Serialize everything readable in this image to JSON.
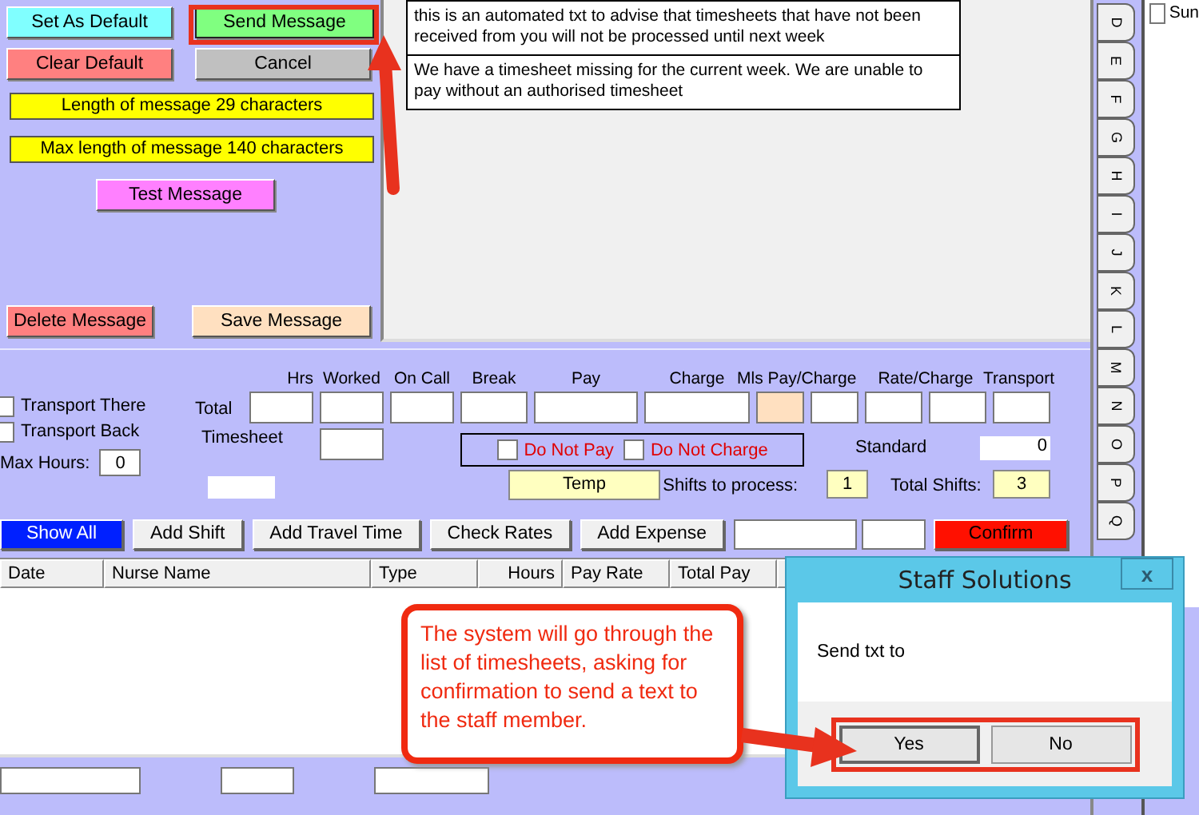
{
  "message_panel": {
    "set_default_button": "Set As Default",
    "send_message_button": "Send Message",
    "clear_default_button": "Clear Default",
    "cancel_button": "Cancel",
    "length_info": "Length of message 29 characters",
    "max_length_info": "Max length of message 140 characters",
    "test_message_button": "Test Message",
    "delete_message_button": "Delete Message",
    "save_message_button": "Save Message"
  },
  "messages": [
    "this is an automated txt to advise that  timesheets that have not been received from you will not be processed until next week",
    "We have a timesheet missing for the current week. We are unable to pay without an authorised timesheet"
  ],
  "letter_tabs": [
    "D",
    "E",
    "F",
    "G",
    "H",
    "I",
    "J",
    "K",
    "L",
    "M",
    "N",
    "O",
    "P",
    "Q"
  ],
  "side_checkbox": {
    "label": "Sun",
    "checked": false
  },
  "options": [
    {
      "label": "Transport There",
      "checked": false
    },
    {
      "label": "Transport Back",
      "checked": false
    }
  ],
  "max_hours": {
    "label": "Max Hours:",
    "value": "0"
  },
  "totals": {
    "columns": [
      "Hrs",
      "Worked",
      "On Call",
      "Break",
      "Pay",
      "Charge",
      "Mls Pay/Charge",
      "Rate/Charge",
      "Transport"
    ],
    "total_label": "Total",
    "timesheet_label": "Timesheet"
  },
  "charge_flags": [
    {
      "label": "Do Not Pay",
      "checked": false
    },
    {
      "label": "Do Not Charge",
      "checked": false
    }
  ],
  "standard": {
    "label": "Standard",
    "value": "0"
  },
  "shift_type": "Temp",
  "shifts_to_process": {
    "label": "Shifts to process:",
    "value": "1"
  },
  "total_shifts": {
    "label": "Total Shifts:",
    "value": "3"
  },
  "toolbar": [
    {
      "label": "Show All",
      "kind": "primary"
    },
    {
      "label": "Add Shift",
      "kind": "normal"
    },
    {
      "label": "Add Travel Time",
      "kind": "normal"
    },
    {
      "label": "Check Rates",
      "kind": "normal"
    },
    {
      "label": "Add Expense",
      "kind": "normal"
    },
    {
      "label": "Confirm",
      "kind": "danger"
    }
  ],
  "table": {
    "columns": [
      "Date",
      "Nurse Name",
      "Type",
      "Hours",
      "Pay Rate",
      "Total Pay"
    ]
  },
  "callout": "The system will go through the list of timesheets, asking for confirmation to send a text to the staff member.",
  "dialog": {
    "title": "Staff Solutions",
    "close": "x",
    "message": "Send txt to",
    "buttons": [
      "Yes",
      "No"
    ]
  }
}
